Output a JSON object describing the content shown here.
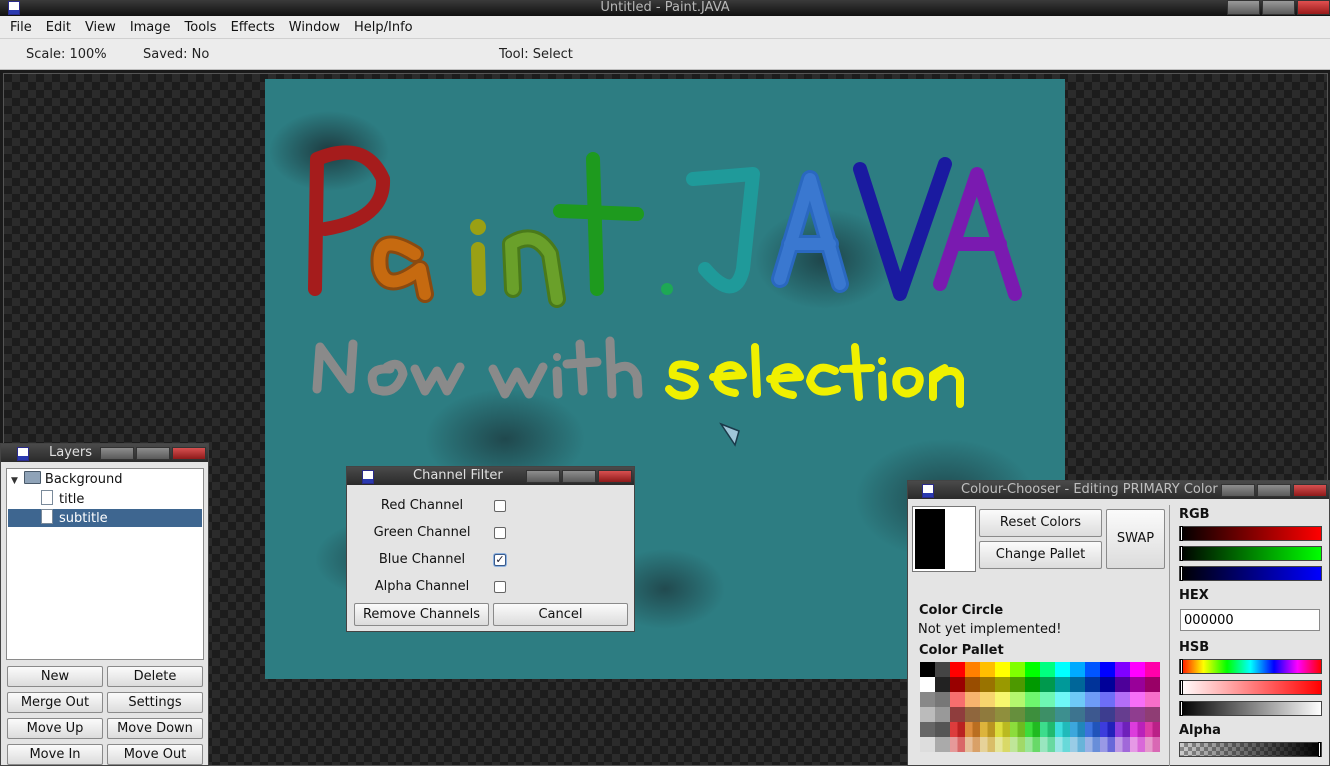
{
  "window": {
    "title": "Untitled - Paint.JAVA"
  },
  "menu": [
    "File",
    "Edit",
    "View",
    "Image",
    "Tools",
    "Effects",
    "Window",
    "Help/Info"
  ],
  "status": {
    "scale": "Scale: 100%",
    "saved": "Saved: No",
    "tool": "Tool: Select"
  },
  "canvas": {
    "title_text": "Paint.JAVA",
    "subtitle_gray": "Now with",
    "subtitle_yellow": "selection",
    "colors": {
      "p": "#a51c1c",
      "a": "#c66a10",
      "i": "#9aa014",
      "n": "#6aa02a",
      "t": "#1e9a1e",
      "dot": "#1ea855",
      "j": "#1f9a9a",
      "a2": "#2a68c0",
      "v": "#1a1aa0",
      "a3": "#7a1ab0",
      "gray": "#8a8a8a",
      "yellow": "#f0f000"
    }
  },
  "layers": {
    "title": "Layers",
    "tree": [
      {
        "label": "Background",
        "type": "folder"
      },
      {
        "label": "title",
        "type": "file"
      },
      {
        "label": "subtitle",
        "type": "file",
        "selected": true
      }
    ],
    "buttons": [
      "New",
      "Delete",
      "Merge Out",
      "Settings",
      "Move Up",
      "Move Down",
      "Move In",
      "Move Out"
    ]
  },
  "channel_filter": {
    "title": "Channel Filter",
    "channels": [
      {
        "label": "Red Channel",
        "checked": false
      },
      {
        "label": "Green Channel",
        "checked": false
      },
      {
        "label": "Blue Channel",
        "checked": true
      },
      {
        "label": "Alpha Channel",
        "checked": false
      }
    ],
    "remove_label": "Remove Channels",
    "cancel_label": "Cancel"
  },
  "colour_chooser": {
    "title": "Colour-Chooser - Editing PRIMARY Color",
    "reset_label": "Reset Colors",
    "change_label": "Change Pallet",
    "swap_label": "SWAP",
    "circle_heading": "Color Circle",
    "circle_note": "Not yet implemented!",
    "pallet_heading": "Color Pallet",
    "rgb_label": "RGB",
    "hex_label": "HEX",
    "hex_value": "000000",
    "hsb_label": "HSB",
    "alpha_label": "Alpha",
    "primary_color": "#000000",
    "secondary_color": "#ffffff"
  }
}
